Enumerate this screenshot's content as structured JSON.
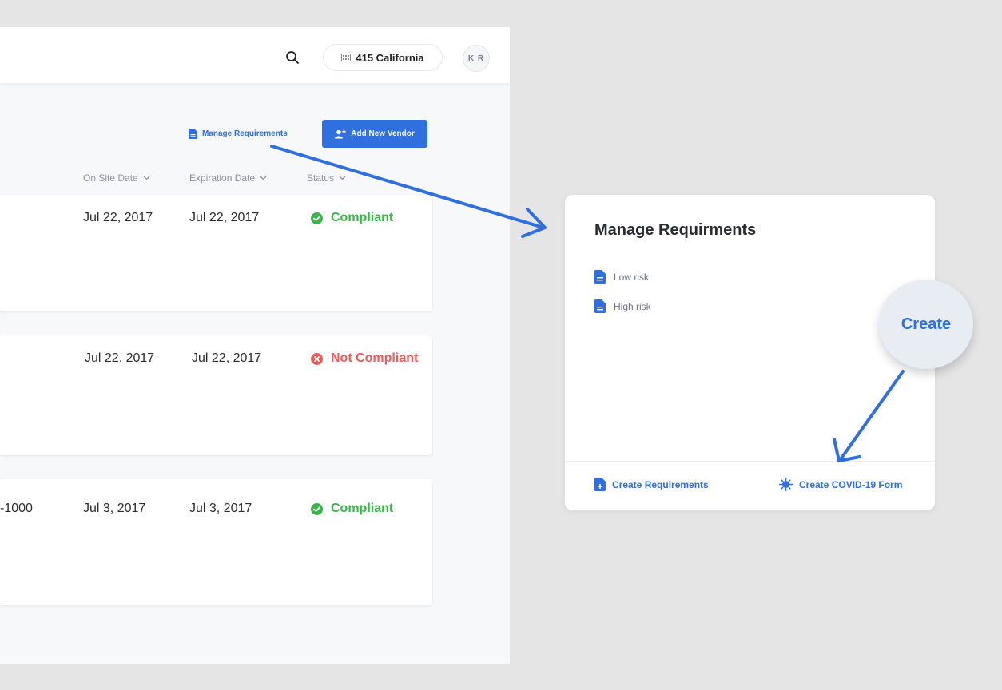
{
  "topbar": {
    "search_icon": "search-icon",
    "location_label": "415 California",
    "avatar_initials": "K R"
  },
  "toolbar": {
    "manage_requirements_label": "Manage Requirements",
    "add_vendor_label": "Add New Vendor"
  },
  "table": {
    "columns": [
      {
        "label": "On Site Date"
      },
      {
        "label": "Expiration Date"
      },
      {
        "label": "Status"
      }
    ],
    "rows": [
      {
        "leading": "",
        "on_site": "Jul 22, 2017",
        "expiration": "Jul 22, 2017",
        "status": "Compliant",
        "status_kind": "ok"
      },
      {
        "leading": "",
        "on_site": "Jul 22, 2017",
        "expiration": "Jul 22, 2017",
        "status": "Not Compliant",
        "status_kind": "bad"
      },
      {
        "leading": "-1000",
        "on_site": "Jul 3, 2017",
        "expiration": "Jul 3, 2017",
        "status": "Compliant",
        "status_kind": "ok"
      }
    ]
  },
  "modal": {
    "title": "Manage Requirments",
    "items": [
      {
        "label": "Low risk"
      },
      {
        "label": "High risk"
      }
    ],
    "footer": {
      "create_requirements": "Create Requirements",
      "create_covid_form": "Create COVID-19 Form"
    }
  },
  "annotation": {
    "bubble_label": "Create"
  },
  "colors": {
    "accent": "#2f6fe0",
    "compliant": "#3bb54a",
    "not_compliant": "#ef5a5a"
  }
}
